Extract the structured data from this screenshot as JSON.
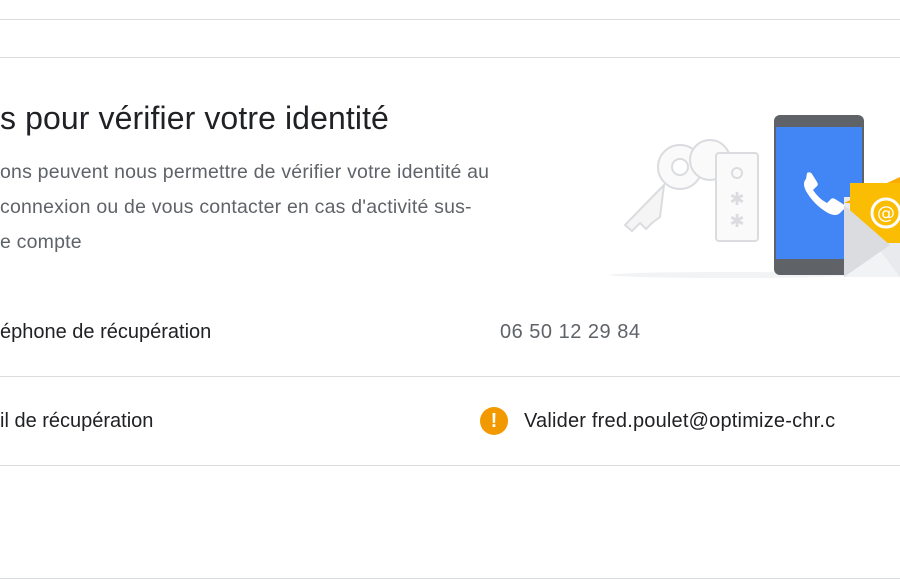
{
  "section": {
    "title": "s pour vérifier votre identité",
    "description": "ons peuvent nous permettre de vérifier votre identité au connexion ou de vous contacter en cas d'activité sus- e compte",
    "description_lines": [
      "ons peuvent nous permettre de vérifier votre identité au",
      " connexion ou de vous contacter en cas d'activité sus-",
      "e compte"
    ]
  },
  "rows": [
    {
      "label": "éphone de récupération",
      "value": "06 50 12 29 84"
    },
    {
      "label": "il de récupération",
      "value": "Valider fred.poulet@optimize-chr.c",
      "status_icon": "warning-icon",
      "status_glyph": "!"
    }
  ],
  "colors": {
    "warning": "#f29900",
    "phone_screen": "#4285f4",
    "envelope": "#fbbc04",
    "divider": "#dadce0"
  }
}
